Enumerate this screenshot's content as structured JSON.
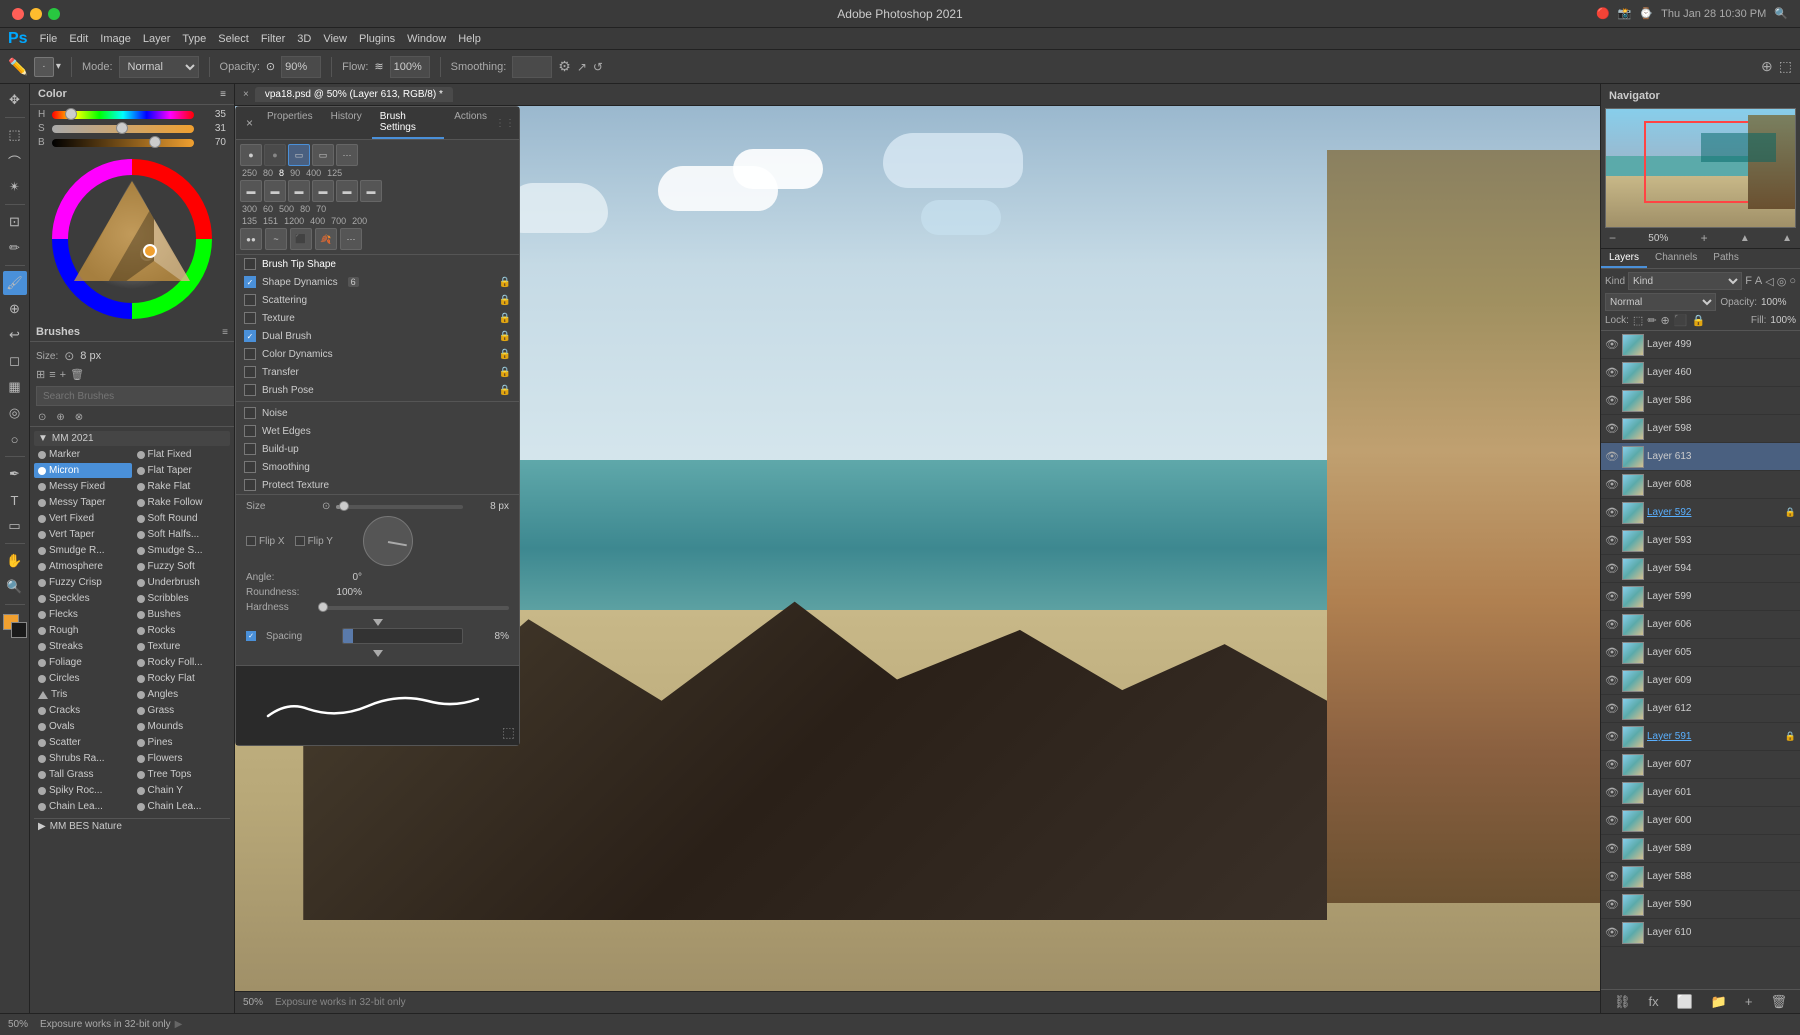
{
  "app": {
    "title": "Adobe Photoshop 2021",
    "window_title": "vpa18.psd @ 50% (Layer 613, RGB/8) *",
    "datetime": "Thu Jan 28  10:30 PM"
  },
  "menu": {
    "items": [
      "Ps",
      "File",
      "Edit",
      "Image",
      "Layer",
      "Type",
      "Select",
      "Filter",
      "3D",
      "View",
      "Plugins",
      "Window",
      "Help"
    ]
  },
  "toolbar": {
    "mode_label": "Mode:",
    "mode_value": "Normal",
    "opacity_label": "Opacity:",
    "opacity_value": "90%",
    "flow_label": "Flow:",
    "flow_value": "100%",
    "smoothing_label": "Smoothing:",
    "smoothing_value": ""
  },
  "color_panel": {
    "title": "Color",
    "h_value": "35",
    "s_value": "31",
    "b_value": "70"
  },
  "brushes_panel": {
    "title": "Brushes",
    "size_label": "Size:",
    "size_value": "8 px",
    "search_placeholder": "Search Brushes",
    "group": "MM 2021",
    "items_col1": [
      "Marker",
      "Micron",
      "Messy Fixed",
      "Messy Taper",
      "Vert Fixed",
      "Vert Taper",
      "Smudge R...",
      "Atmosphere",
      "Fuzzy Crisp",
      "Speckles",
      "Flecks",
      "Rough",
      "Streaks",
      "Foliage",
      "Circles",
      "Tris",
      "Cracks",
      "Ovals",
      "Scatter",
      "Shrubs Ra...",
      "Tall Grass",
      "Spiky Roc...",
      "Chain Lea...",
      "MM BES Nature"
    ],
    "items_col2": [
      "Flat Fixed",
      "Flat Taper",
      "Rake Flat",
      "Rake Follow",
      "Soft Round",
      "Soft Halfs...",
      "Smudge S...",
      "Fuzzy Soft",
      "Underbrush",
      "Scribbles",
      "Bushes",
      "Rocks",
      "Texture",
      "Rocky Foll...",
      "Rocky Flat",
      "Angles",
      "Grass",
      "Mounds",
      "Pines",
      "Flowers",
      "Tree Tops",
      "Chain Y",
      "Chain Lea...",
      ""
    ]
  },
  "brush_settings": {
    "panel_title": "Brush Settings",
    "tabs": [
      "Properties",
      "History",
      "Brush Settings",
      "Actions"
    ],
    "active_tab": "Brush Settings",
    "preset_sizes": [
      "250",
      "80",
      "8",
      "90",
      "400",
      "125"
    ],
    "settings": [
      {
        "label": "Brush Tip Shape",
        "checked": false,
        "locked": false
      },
      {
        "label": "Shape Dynamics",
        "checked": true,
        "locked": true,
        "badge": "6"
      },
      {
        "label": "Scattering",
        "checked": false,
        "locked": true
      },
      {
        "label": "Texture",
        "checked": false,
        "locked": true
      },
      {
        "label": "Dual Brush",
        "checked": true,
        "locked": true
      },
      {
        "label": "Color Dynamics",
        "checked": false,
        "locked": true
      },
      {
        "label": "Transfer",
        "checked": false,
        "locked": true
      },
      {
        "label": "Brush Pose",
        "checked": false,
        "locked": true
      },
      {
        "label": "Noise",
        "checked": false,
        "locked": false
      },
      {
        "label": "Wet Edges",
        "checked": false,
        "locked": false
      },
      {
        "label": "Build-up",
        "checked": false,
        "locked": false
      },
      {
        "label": "Smoothing",
        "checked": false,
        "locked": false
      },
      {
        "label": "Protect Texture",
        "checked": false,
        "locked": false
      }
    ],
    "size_label": "Size",
    "size_value": "8 px",
    "flip_x": "Flip X",
    "flip_y": "Flip Y",
    "angle_label": "Angle:",
    "angle_value": "0°",
    "roundness_label": "Roundness:",
    "roundness_value": "100%",
    "hardness_label": "Hardness",
    "spacing_label": "Spacing",
    "spacing_value": "8%",
    "spacing_checked": true
  },
  "navigator": {
    "title": "Navigator",
    "zoom_value": "50%"
  },
  "layers": {
    "tabs": [
      "Layers",
      "Channels",
      "Paths"
    ],
    "active_tab": "Layers",
    "kind_label": "Kind",
    "mode_value": "Normal",
    "opacity_label": "Opacity:",
    "opacity_value": "100%",
    "lock_label": "Lock:",
    "fill_label": "Fill:",
    "fill_value": "100%",
    "items": [
      {
        "name": "Layer 499",
        "visible": true,
        "locked": false,
        "active": false
      },
      {
        "name": "Layer 460",
        "visible": true,
        "locked": false,
        "active": false
      },
      {
        "name": "Layer 586",
        "visible": true,
        "locked": false,
        "active": false
      },
      {
        "name": "Layer 598",
        "visible": true,
        "locked": false,
        "active": false
      },
      {
        "name": "Layer 613",
        "visible": true,
        "locked": false,
        "active": true
      },
      {
        "name": "Layer 608",
        "visible": true,
        "locked": false,
        "active": false
      },
      {
        "name": "Layer 592",
        "visible": true,
        "locked": false,
        "active": false,
        "underline": true
      },
      {
        "name": "Layer 593",
        "visible": true,
        "locked": false,
        "active": false
      },
      {
        "name": "Layer 594",
        "visible": true,
        "locked": false,
        "active": false
      },
      {
        "name": "Layer 599",
        "visible": true,
        "locked": false,
        "active": false
      },
      {
        "name": "Layer 606",
        "visible": true,
        "locked": false,
        "active": false
      },
      {
        "name": "Layer 605",
        "visible": true,
        "locked": false,
        "active": false
      },
      {
        "name": "Layer 609",
        "visible": true,
        "locked": false,
        "active": false
      },
      {
        "name": "Layer 612",
        "visible": true,
        "locked": false,
        "active": false
      },
      {
        "name": "Layer 591",
        "visible": true,
        "locked": false,
        "active": false,
        "underline": true
      },
      {
        "name": "Layer 607",
        "visible": true,
        "locked": false,
        "active": false
      },
      {
        "name": "Layer 601",
        "visible": true,
        "locked": false,
        "active": false
      },
      {
        "name": "Layer 600",
        "visible": true,
        "locked": false,
        "active": false
      },
      {
        "name": "Layer 589",
        "visible": true,
        "locked": false,
        "active": false
      },
      {
        "name": "Layer 588",
        "visible": true,
        "locked": false,
        "active": false
      },
      {
        "name": "Layer 590",
        "visible": true,
        "locked": false,
        "active": false
      },
      {
        "name": "Layer 610",
        "visible": true,
        "locked": false,
        "active": false
      }
    ]
  },
  "status_bar": {
    "zoom": "50%",
    "message": "Exposure works in 32-bit only"
  }
}
